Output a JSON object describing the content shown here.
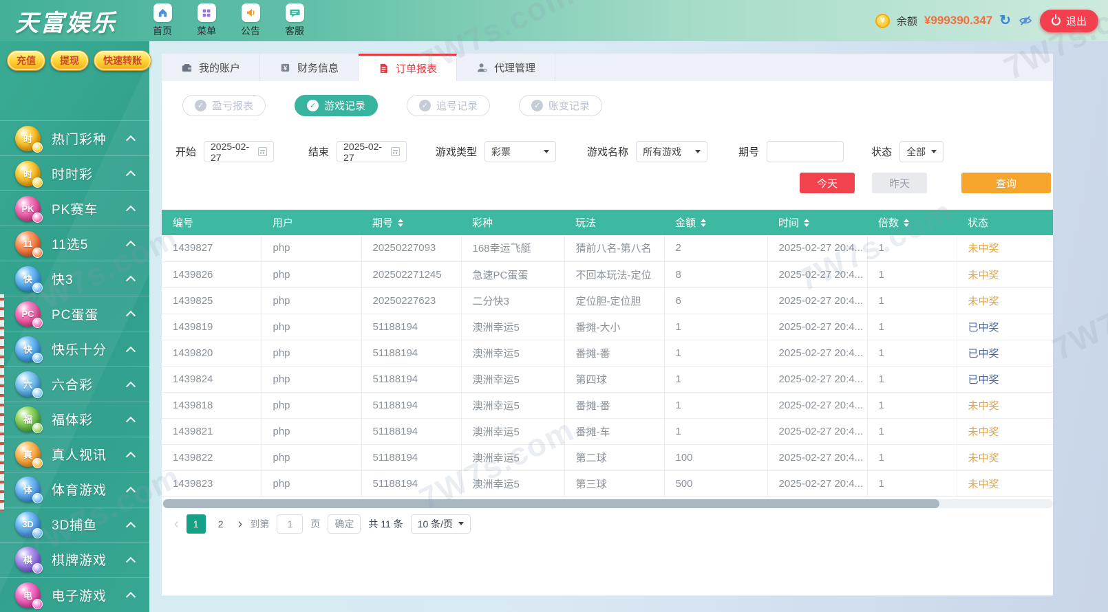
{
  "watermark": "7W7s.com",
  "colors": {
    "header_teal": "#3cb9a0",
    "sidebar_teal": "#34a692",
    "win_blue": "#4066b0",
    "lose_orange": "#e6a23c",
    "today_red": "#f2424d",
    "search_orange": "#f5a52c",
    "balance_orange": "#f0703d",
    "logout_red": "#f2404e"
  },
  "topbar": {
    "logo": "天富娱乐",
    "nav": [
      {
        "label": "首页"
      },
      {
        "label": "菜单"
      },
      {
        "label": "公告"
      },
      {
        "label": "客服"
      }
    ],
    "balance_label": "余额",
    "balance_amount": "¥999390.347",
    "logout_label": "退出"
  },
  "sidebar": {
    "actions": [
      {
        "label": "充值"
      },
      {
        "label": "提现"
      },
      {
        "label": "快速转账"
      }
    ],
    "items": [
      {
        "label": "热门彩种",
        "badge": "时",
        "c1": "#ffd54a",
        "c2": "#f09c00"
      },
      {
        "label": "时时彩",
        "badge": "时",
        "c1": "#ffd54a",
        "c2": "#f09c00"
      },
      {
        "label": "PK赛车",
        "badge": "PK",
        "c1": "#f77fc0",
        "c2": "#e0368f"
      },
      {
        "label": "11选5",
        "badge": "11",
        "c1": "#ff9d66",
        "c2": "#ef5a24"
      },
      {
        "label": "快3",
        "badge": "快",
        "c1": "#7cc4f8",
        "c2": "#2f8fe8"
      },
      {
        "label": "PC蛋蛋",
        "badge": "PC",
        "c1": "#f77fc0",
        "c2": "#e8378f"
      },
      {
        "label": "快乐十分",
        "badge": "快",
        "c1": "#7cc4f8",
        "c2": "#2f8fe8"
      },
      {
        "label": "六合彩",
        "badge": "六",
        "c1": "#8fd0f5",
        "c2": "#3d9be0"
      },
      {
        "label": "福体彩",
        "badge": "福",
        "c1": "#9fdc6a",
        "c2": "#45a838"
      },
      {
        "label": "真人视讯",
        "badge": "真",
        "c1": "#ffc166",
        "c2": "#f58f1e"
      },
      {
        "label": "体育游戏",
        "badge": "体",
        "c1": "#7cc4f8",
        "c2": "#3a87e0"
      },
      {
        "label": "3D捕鱼",
        "badge": "3D",
        "c1": "#7cc4f8",
        "c2": "#3a87e0"
      },
      {
        "label": "棋牌游戏",
        "badge": "棋",
        "c1": "#b59df2",
        "c2": "#7a52d8"
      },
      {
        "label": "电子游戏",
        "badge": "电",
        "c1": "#f77fd0",
        "c2": "#e03398"
      }
    ]
  },
  "tabs": [
    {
      "label": "我的账户"
    },
    {
      "label": "财务信息"
    },
    {
      "label": "订单报表",
      "active": "true"
    },
    {
      "label": "代理管理"
    }
  ],
  "subtabs": [
    {
      "label": "盈亏报表"
    },
    {
      "label": "游戏记录",
      "active": "true"
    },
    {
      "label": "追号记录"
    },
    {
      "label": "账变记录"
    }
  ],
  "filters": {
    "start_label": "开始",
    "start_value": "2025-02-27",
    "end_label": "结束",
    "end_value": "2025-02-27",
    "game_type_label": "游戏类型",
    "game_type_value": "彩票",
    "game_name_label": "游戏名称",
    "game_name_value": "所有游戏",
    "issue_label": "期号",
    "issue_value": "",
    "status_label": "状态",
    "status_value": "全部"
  },
  "actions": {
    "today": "今天",
    "yesterday": "昨天",
    "search": "查询"
  },
  "table": {
    "headers": [
      {
        "label": "编号"
      },
      {
        "label": "用户"
      },
      {
        "label": "期号",
        "sortable": "true"
      },
      {
        "label": "彩种"
      },
      {
        "label": "玩法"
      },
      {
        "label": "金额",
        "sortable": "true"
      },
      {
        "label": "时间",
        "sortable": "true"
      },
      {
        "label": "倍数",
        "sortable": "true"
      },
      {
        "label": "状态"
      }
    ],
    "rows": [
      {
        "id": "1439827",
        "user": "php",
        "issue": "20250227093",
        "lottery": "168幸运飞艇",
        "play": "猜前八名-第八名",
        "amount": "2",
        "time": "2025-02-27 20:4...",
        "multiple": "1",
        "status": {
          "text": "未中奖",
          "type": "lose"
        }
      },
      {
        "id": "1439826",
        "user": "php",
        "issue": "202502271245",
        "lottery": "急速PC蛋蛋",
        "play": "不回本玩法-定位",
        "amount": "8",
        "time": "2025-02-27 20:4...",
        "multiple": "1",
        "status": {
          "text": "未中奖",
          "type": "lose"
        }
      },
      {
        "id": "1439825",
        "user": "php",
        "issue": "20250227623",
        "lottery": "二分快3",
        "play": "定位胆-定位胆",
        "amount": "6",
        "time": "2025-02-27 20:4...",
        "multiple": "1",
        "status": {
          "text": "未中奖",
          "type": "lose"
        }
      },
      {
        "id": "1439819",
        "user": "php",
        "issue": "51188194",
        "lottery": "澳洲幸运5",
        "play": "番摊-大小",
        "amount": "1",
        "time": "2025-02-27 20:4...",
        "multiple": "1",
        "status": {
          "text": "已中奖",
          "type": "win"
        }
      },
      {
        "id": "1439820",
        "user": "php",
        "issue": "51188194",
        "lottery": "澳洲幸运5",
        "play": "番摊-番",
        "amount": "1",
        "time": "2025-02-27 20:4...",
        "multiple": "1",
        "status": {
          "text": "已中奖",
          "type": "win"
        }
      },
      {
        "id": "1439824",
        "user": "php",
        "issue": "51188194",
        "lottery": "澳洲幸运5",
        "play": "第四球",
        "amount": "1",
        "time": "2025-02-27 20:4...",
        "multiple": "1",
        "status": {
          "text": "已中奖",
          "type": "win"
        }
      },
      {
        "id": "1439818",
        "user": "php",
        "issue": "51188194",
        "lottery": "澳洲幸运5",
        "play": "番摊-番",
        "amount": "1",
        "time": "2025-02-27 20:4...",
        "multiple": "1",
        "status": {
          "text": "未中奖",
          "type": "lose"
        }
      },
      {
        "id": "1439821",
        "user": "php",
        "issue": "51188194",
        "lottery": "澳洲幸运5",
        "play": "番摊-车",
        "amount": "1",
        "time": "2025-02-27 20:4...",
        "multiple": "1",
        "status": {
          "text": "未中奖",
          "type": "lose"
        }
      },
      {
        "id": "1439822",
        "user": "php",
        "issue": "51188194",
        "lottery": "澳洲幸运5",
        "play": "第二球",
        "amount": "100",
        "time": "2025-02-27 20:4...",
        "multiple": "1",
        "status": {
          "text": "未中奖",
          "type": "lose"
        }
      },
      {
        "id": "1439823",
        "user": "php",
        "issue": "51188194",
        "lottery": "澳洲幸运5",
        "play": "第三球",
        "amount": "500",
        "time": "2025-02-27 20:4...",
        "multiple": "1",
        "status": {
          "text": "未中奖",
          "type": "lose"
        }
      }
    ]
  },
  "pagination": {
    "prev": "‹",
    "next": "›",
    "pages": [
      {
        "num": "1",
        "active": "true"
      },
      {
        "num": "2"
      }
    ],
    "goto_label": "到第",
    "goto_value": "1",
    "page_unit": "页",
    "confirm_label": "确定",
    "total_label": "共 11 条",
    "per_page": "10 条/页"
  }
}
